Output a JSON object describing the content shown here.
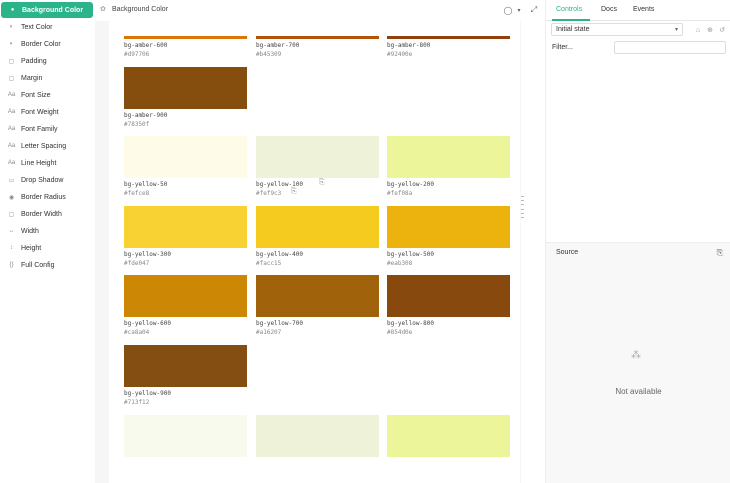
{
  "sidebar": {
    "items": [
      {
        "label": "Background Color",
        "icon": "palette-icon",
        "glyph": "●",
        "active": true
      },
      {
        "label": "Text Color",
        "icon": "text-color-icon",
        "glyph": "◐"
      },
      {
        "label": "Border Color",
        "icon": "border-color-icon",
        "glyph": "◐"
      },
      {
        "label": "Padding",
        "icon": "padding-icon",
        "glyph": "▢"
      },
      {
        "label": "Margin",
        "icon": "margin-icon",
        "glyph": "▢"
      },
      {
        "label": "Font Size",
        "icon": "font-size-icon",
        "glyph": "Aa"
      },
      {
        "label": "Font Weight",
        "icon": "font-weight-icon",
        "glyph": "Aa"
      },
      {
        "label": "Font Family",
        "icon": "font-family-icon",
        "glyph": "Aa"
      },
      {
        "label": "Letter Spacing",
        "icon": "letter-spacing-icon",
        "glyph": "Aa"
      },
      {
        "label": "Line Height",
        "icon": "line-height-icon",
        "glyph": "Aa"
      },
      {
        "label": "Drop Shadow",
        "icon": "shadow-icon",
        "glyph": "▭"
      },
      {
        "label": "Border Radius",
        "icon": "border-radius-icon",
        "glyph": "◉"
      },
      {
        "label": "Border Width",
        "icon": "border-width-icon",
        "glyph": "▢"
      },
      {
        "label": "Width",
        "icon": "width-icon",
        "glyph": "↔"
      },
      {
        "label": "Height",
        "icon": "height-icon",
        "glyph": "↕"
      },
      {
        "label": "Full Config",
        "icon": "config-icon",
        "glyph": "{}"
      }
    ]
  },
  "topbar": {
    "breadcrumb": "Background Color",
    "breadcrumb_icon": "palette-icon",
    "tools": [
      {
        "name": "theme-circle-icon",
        "glyph": "◯"
      },
      {
        "name": "chevron-down-icon",
        "glyph": "▾"
      },
      {
        "name": "fullscreen-icon",
        "glyph": "⤢"
      }
    ]
  },
  "canvas": {
    "top_row": [
      {
        "name": "bg-amber-600",
        "hex": "#d97706",
        "color": "#d97706"
      },
      {
        "name": "bg-amber-700",
        "hex": "#b45309",
        "color": "#b45309"
      },
      {
        "name": "bg-amber-800",
        "hex": "#92400e",
        "color": "#92400e"
      }
    ],
    "swatches": [
      {
        "name": "bg-amber-900",
        "hex": "#78350f",
        "color": "#854d0e"
      },
      {
        "name": "bg-yellow-50",
        "hex": "#fefce8",
        "color": "#fefce8"
      },
      {
        "name": "bg-yellow-100",
        "hex": "#fef9c3",
        "color": "#eef2d8",
        "copy": true
      },
      {
        "name": "bg-yellow-200",
        "hex": "#fef08a",
        "color": "#ecf599"
      },
      {
        "name": "bg-yellow-300",
        "hex": "#fde047",
        "color": "#f7d232"
      },
      {
        "name": "bg-yellow-400",
        "hex": "#facc15",
        "color": "#f6cb1f"
      },
      {
        "name": "bg-yellow-500",
        "hex": "#eab308",
        "color": "#ecb20e"
      },
      {
        "name": "bg-yellow-600",
        "hex": "#ca8a04",
        "color": "#cc8804"
      },
      {
        "name": "bg-yellow-700",
        "hex": "#a16207",
        "color": "#a0630c"
      },
      {
        "name": "bg-yellow-800",
        "hex": "#854d0e",
        "color": "#88490f"
      },
      {
        "name": "bg-yellow-900",
        "hex": "#713f12",
        "color": "#844d11"
      },
      {
        "name": "",
        "hex": "",
        "color": "#f7faed"
      },
      {
        "name": "",
        "hex": "",
        "color": "#eef2d8"
      },
      {
        "name": "",
        "hex": "",
        "color": "#ecf599"
      }
    ]
  },
  "panel": {
    "tabs": [
      "Controls",
      "Docs",
      "Events"
    ],
    "active_tab": "Controls",
    "state_select": "Initial state",
    "icons": [
      {
        "name": "lock-icon",
        "glyph": "⌂"
      },
      {
        "name": "add-icon",
        "glyph": "⊕"
      },
      {
        "name": "reset-icon",
        "glyph": "↺"
      }
    ],
    "filter_label": "Filter...",
    "source_title": "Source",
    "not_available": "Not available"
  },
  "colors": {
    "accent": "#2bb38a",
    "canvas_bg": "#f6f6f6"
  }
}
